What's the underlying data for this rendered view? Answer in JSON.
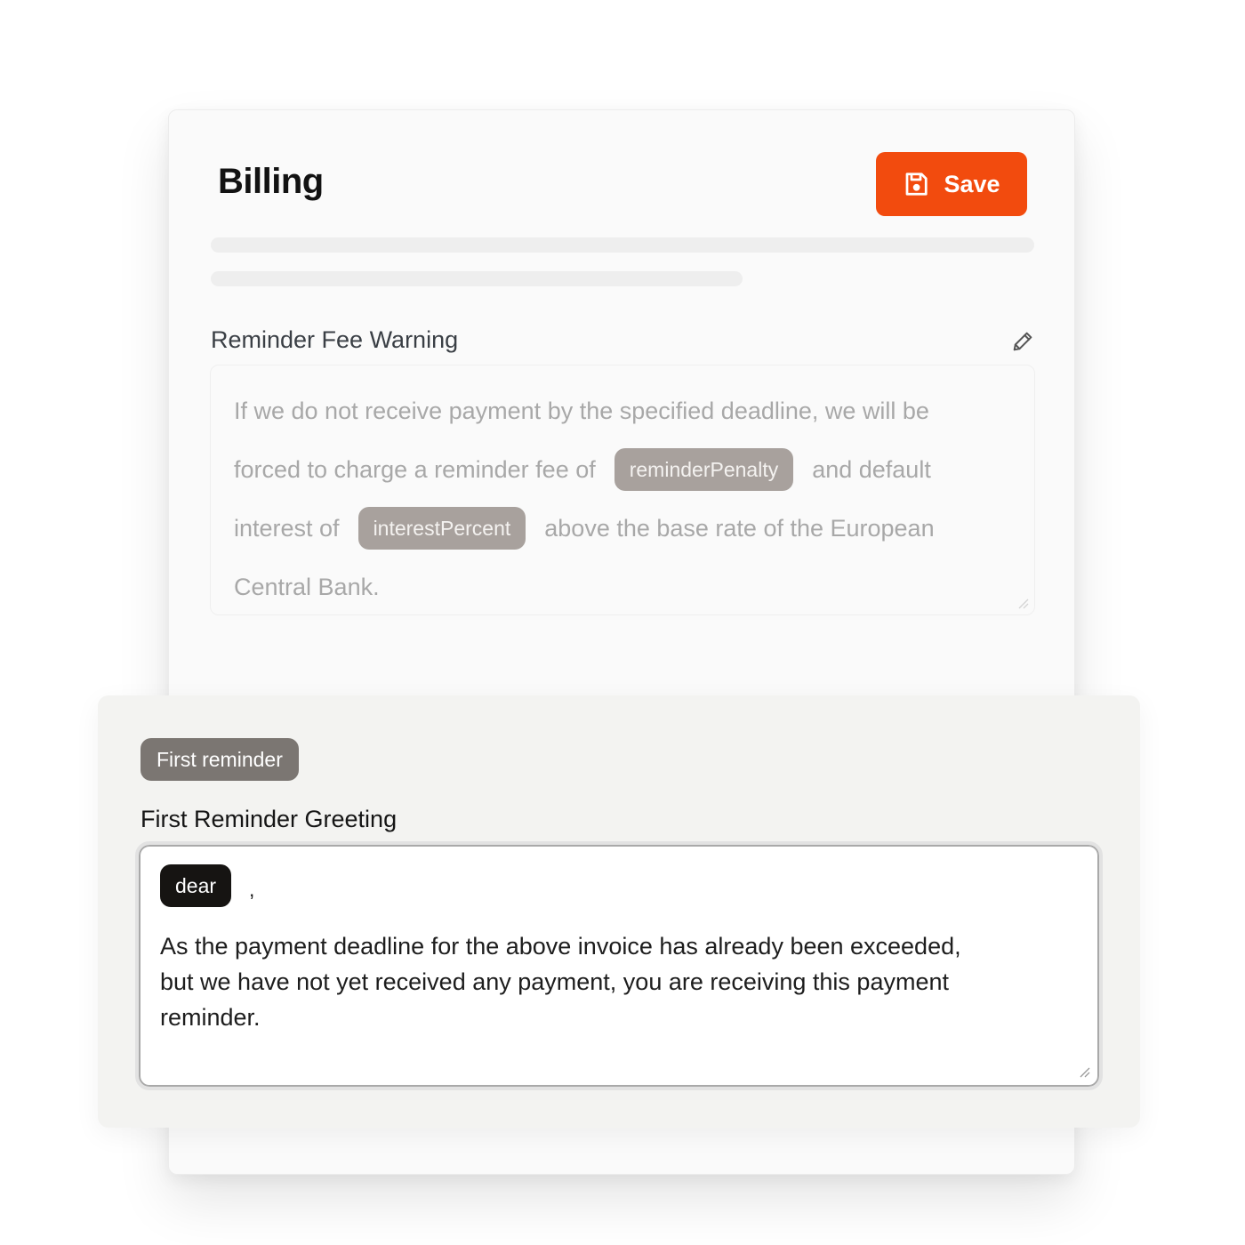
{
  "billing": {
    "title": "Billing",
    "save_label": "Save"
  },
  "reminder_fee": {
    "label": "Reminder Fee Warning",
    "text_line1": "If we do not receive payment by the specified deadline, we will be",
    "text_line2_a": "forced to charge a reminder fee of",
    "variable_1": "reminderPenalty",
    "text_line2_b": "and default",
    "text_line3_a": "interest of",
    "variable_2": "interestPercent",
    "text_line3_b": "above the base rate of the European",
    "text_line4": "Central Bank."
  },
  "first_reminder": {
    "badge": "First reminder",
    "label": "First Reminder Greeting",
    "variable": "dear",
    "comma": ",",
    "body_line1": "As the payment deadline for the above invoice has already been exceeded,",
    "body_line2": "but we have not yet received any payment, you are receiving this payment",
    "body_line3": "reminder."
  },
  "colors": {
    "accent": "#f24b0e",
    "chip_muted": "#a8a19d",
    "chip_dark": "#161412",
    "badge": "#7b7672"
  }
}
